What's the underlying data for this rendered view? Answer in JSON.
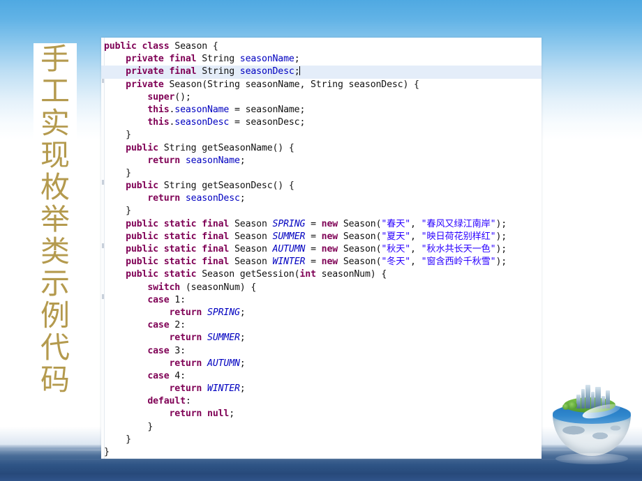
{
  "slide": {
    "title_vertical": "手工实现枚举类示例代码",
    "title_chars": [
      "手",
      "工",
      "实",
      "现",
      "枚",
      "举",
      "类",
      "示",
      "例",
      "代",
      "码"
    ],
    "colors": {
      "sky_top": "#4fa9e2",
      "sea": "#2f5586",
      "title_gold": "#b49a4e",
      "code_keyword": "#7f0055",
      "code_field": "#0000c0",
      "code_string": "#2a00ff",
      "code_plain": "#111111",
      "line_highlight": "#e4edf9",
      "panel_background": "#ffffff"
    },
    "decoration": {
      "globe_icon": "earth-globe-with-city-icon"
    }
  },
  "code": {
    "language": "Java",
    "class_name": "Season",
    "caret_line_index": 2,
    "lines": [
      {
        "indent": 0,
        "tokens": [
          {
            "t": "kw",
            "v": "public"
          },
          {
            "t": "pln",
            "v": " "
          },
          {
            "t": "kw",
            "v": "class"
          },
          {
            "t": "pln",
            "v": " Season {"
          }
        ]
      },
      {
        "indent": 1,
        "tokens": [
          {
            "t": "kw",
            "v": "private"
          },
          {
            "t": "pln",
            "v": " "
          },
          {
            "t": "kw",
            "v": "final"
          },
          {
            "t": "pln",
            "v": " String "
          },
          {
            "t": "fld",
            "v": "seasonName"
          },
          {
            "t": "pln",
            "v": ";"
          }
        ]
      },
      {
        "indent": 1,
        "highlight": true,
        "caret": true,
        "tokens": [
          {
            "t": "kw",
            "v": "private"
          },
          {
            "t": "pln",
            "v": " "
          },
          {
            "t": "kw",
            "v": "final"
          },
          {
            "t": "pln",
            "v": " String "
          },
          {
            "t": "fld",
            "v": "seasonDesc"
          },
          {
            "t": "pln",
            "v": ";"
          }
        ]
      },
      {
        "indent": 1,
        "tokens": [
          {
            "t": "kw",
            "v": "private"
          },
          {
            "t": "pln",
            "v": " Season(String seasonName, String seasonDesc) {"
          }
        ]
      },
      {
        "indent": 2,
        "tokens": [
          {
            "t": "kw",
            "v": "super"
          },
          {
            "t": "pln",
            "v": "();"
          }
        ]
      },
      {
        "indent": 2,
        "tokens": [
          {
            "t": "kw",
            "v": "this"
          },
          {
            "t": "pln",
            "v": "."
          },
          {
            "t": "fld",
            "v": "seasonName"
          },
          {
            "t": "pln",
            "v": " = seasonName;"
          }
        ]
      },
      {
        "indent": 2,
        "tokens": [
          {
            "t": "kw",
            "v": "this"
          },
          {
            "t": "pln",
            "v": "."
          },
          {
            "t": "fld",
            "v": "seasonDesc"
          },
          {
            "t": "pln",
            "v": " = seasonDesc;"
          }
        ]
      },
      {
        "indent": 1,
        "tokens": [
          {
            "t": "pln",
            "v": "}"
          }
        ]
      },
      {
        "indent": 1,
        "tokens": [
          {
            "t": "kw",
            "v": "public"
          },
          {
            "t": "pln",
            "v": " String getSeasonName() {"
          }
        ]
      },
      {
        "indent": 2,
        "tokens": [
          {
            "t": "kw",
            "v": "return"
          },
          {
            "t": "pln",
            "v": " "
          },
          {
            "t": "fld",
            "v": "seasonName"
          },
          {
            "t": "pln",
            "v": ";"
          }
        ]
      },
      {
        "indent": 1,
        "tokens": [
          {
            "t": "pln",
            "v": "}"
          }
        ]
      },
      {
        "indent": 1,
        "tokens": [
          {
            "t": "kw",
            "v": "public"
          },
          {
            "t": "pln",
            "v": " String getSeasonDesc() {"
          }
        ]
      },
      {
        "indent": 2,
        "tokens": [
          {
            "t": "kw",
            "v": "return"
          },
          {
            "t": "pln",
            "v": " "
          },
          {
            "t": "fld",
            "v": "seasonDesc"
          },
          {
            "t": "pln",
            "v": ";"
          }
        ]
      },
      {
        "indent": 1,
        "tokens": [
          {
            "t": "pln",
            "v": "}"
          }
        ]
      },
      {
        "indent": 1,
        "tokens": [
          {
            "t": "kw",
            "v": "public"
          },
          {
            "t": "pln",
            "v": " "
          },
          {
            "t": "kw",
            "v": "static"
          },
          {
            "t": "pln",
            "v": " "
          },
          {
            "t": "kw",
            "v": "final"
          },
          {
            "t": "pln",
            "v": " Season "
          },
          {
            "t": "stfld",
            "v": "SPRING"
          },
          {
            "t": "pln",
            "v": " = "
          },
          {
            "t": "kw",
            "v": "new"
          },
          {
            "t": "pln",
            "v": " Season("
          },
          {
            "t": "str",
            "v": "\"春天\""
          },
          {
            "t": "pln",
            "v": ", "
          },
          {
            "t": "str",
            "v": "\"春风又绿江南岸\""
          },
          {
            "t": "pln",
            "v": ");"
          }
        ]
      },
      {
        "indent": 1,
        "tokens": [
          {
            "t": "kw",
            "v": "public"
          },
          {
            "t": "pln",
            "v": " "
          },
          {
            "t": "kw",
            "v": "static"
          },
          {
            "t": "pln",
            "v": " "
          },
          {
            "t": "kw",
            "v": "final"
          },
          {
            "t": "pln",
            "v": " Season "
          },
          {
            "t": "stfld",
            "v": "SUMMER"
          },
          {
            "t": "pln",
            "v": " = "
          },
          {
            "t": "kw",
            "v": "new"
          },
          {
            "t": "pln",
            "v": " Season("
          },
          {
            "t": "str",
            "v": "\"夏天\""
          },
          {
            "t": "pln",
            "v": ", "
          },
          {
            "t": "str",
            "v": "\"映日荷花别样红\""
          },
          {
            "t": "pln",
            "v": ");"
          }
        ]
      },
      {
        "indent": 1,
        "tokens": [
          {
            "t": "kw",
            "v": "public"
          },
          {
            "t": "pln",
            "v": " "
          },
          {
            "t": "kw",
            "v": "static"
          },
          {
            "t": "pln",
            "v": " "
          },
          {
            "t": "kw",
            "v": "final"
          },
          {
            "t": "pln",
            "v": " Season "
          },
          {
            "t": "stfld",
            "v": "AUTUMN"
          },
          {
            "t": "pln",
            "v": " = "
          },
          {
            "t": "kw",
            "v": "new"
          },
          {
            "t": "pln",
            "v": " Season("
          },
          {
            "t": "str",
            "v": "\"秋天\""
          },
          {
            "t": "pln",
            "v": ", "
          },
          {
            "t": "str",
            "v": "\"秋水共长天一色\""
          },
          {
            "t": "pln",
            "v": ");"
          }
        ]
      },
      {
        "indent": 1,
        "tokens": [
          {
            "t": "kw",
            "v": "public"
          },
          {
            "t": "pln",
            "v": " "
          },
          {
            "t": "kw",
            "v": "static"
          },
          {
            "t": "pln",
            "v": " "
          },
          {
            "t": "kw",
            "v": "final"
          },
          {
            "t": "pln",
            "v": " Season "
          },
          {
            "t": "stfld",
            "v": "WINTER"
          },
          {
            "t": "pln",
            "v": " = "
          },
          {
            "t": "kw",
            "v": "new"
          },
          {
            "t": "pln",
            "v": " Season("
          },
          {
            "t": "str",
            "v": "\"冬天\""
          },
          {
            "t": "pln",
            "v": ", "
          },
          {
            "t": "str",
            "v": "\"窗含西岭千秋雪\""
          },
          {
            "t": "pln",
            "v": ");"
          }
        ]
      },
      {
        "indent": 1,
        "tokens": [
          {
            "t": "kw",
            "v": "public"
          },
          {
            "t": "pln",
            "v": " "
          },
          {
            "t": "kw",
            "v": "static"
          },
          {
            "t": "pln",
            "v": " Season getSession("
          },
          {
            "t": "kw",
            "v": "int"
          },
          {
            "t": "pln",
            "v": " seasonNum) {"
          }
        ]
      },
      {
        "indent": 2,
        "tokens": [
          {
            "t": "kw",
            "v": "switch"
          },
          {
            "t": "pln",
            "v": " (seasonNum) {"
          }
        ]
      },
      {
        "indent": 2,
        "tokens": [
          {
            "t": "kw",
            "v": "case"
          },
          {
            "t": "pln",
            "v": " 1:"
          }
        ]
      },
      {
        "indent": 3,
        "tokens": [
          {
            "t": "kw",
            "v": "return"
          },
          {
            "t": "pln",
            "v": " "
          },
          {
            "t": "stfld",
            "v": "SPRING"
          },
          {
            "t": "pln",
            "v": ";"
          }
        ]
      },
      {
        "indent": 2,
        "tokens": [
          {
            "t": "kw",
            "v": "case"
          },
          {
            "t": "pln",
            "v": " 2:"
          }
        ]
      },
      {
        "indent": 3,
        "tokens": [
          {
            "t": "kw",
            "v": "return"
          },
          {
            "t": "pln",
            "v": " "
          },
          {
            "t": "stfld",
            "v": "SUMMER"
          },
          {
            "t": "pln",
            "v": ";"
          }
        ]
      },
      {
        "indent": 2,
        "tokens": [
          {
            "t": "kw",
            "v": "case"
          },
          {
            "t": "pln",
            "v": " 3:"
          }
        ]
      },
      {
        "indent": 3,
        "tokens": [
          {
            "t": "kw",
            "v": "return"
          },
          {
            "t": "pln",
            "v": " "
          },
          {
            "t": "stfld",
            "v": "AUTUMN"
          },
          {
            "t": "pln",
            "v": ";"
          }
        ]
      },
      {
        "indent": 2,
        "tokens": [
          {
            "t": "kw",
            "v": "case"
          },
          {
            "t": "pln",
            "v": " 4:"
          }
        ]
      },
      {
        "indent": 3,
        "tokens": [
          {
            "t": "kw",
            "v": "return"
          },
          {
            "t": "pln",
            "v": " "
          },
          {
            "t": "stfld",
            "v": "WINTER"
          },
          {
            "t": "pln",
            "v": ";"
          }
        ]
      },
      {
        "indent": 2,
        "tokens": [
          {
            "t": "kw",
            "v": "default"
          },
          {
            "t": "pln",
            "v": ":"
          }
        ]
      },
      {
        "indent": 3,
        "tokens": [
          {
            "t": "kw",
            "v": "return"
          },
          {
            "t": "pln",
            "v": " "
          },
          {
            "t": "kw",
            "v": "null"
          },
          {
            "t": "pln",
            "v": ";"
          }
        ]
      },
      {
        "indent": 2,
        "tokens": [
          {
            "t": "pln",
            "v": "}"
          }
        ]
      },
      {
        "indent": 1,
        "tokens": [
          {
            "t": "pln",
            "v": "}"
          }
        ]
      },
      {
        "indent": 0,
        "tokens": [
          {
            "t": "pln",
            "v": "}"
          }
        ]
      }
    ]
  }
}
